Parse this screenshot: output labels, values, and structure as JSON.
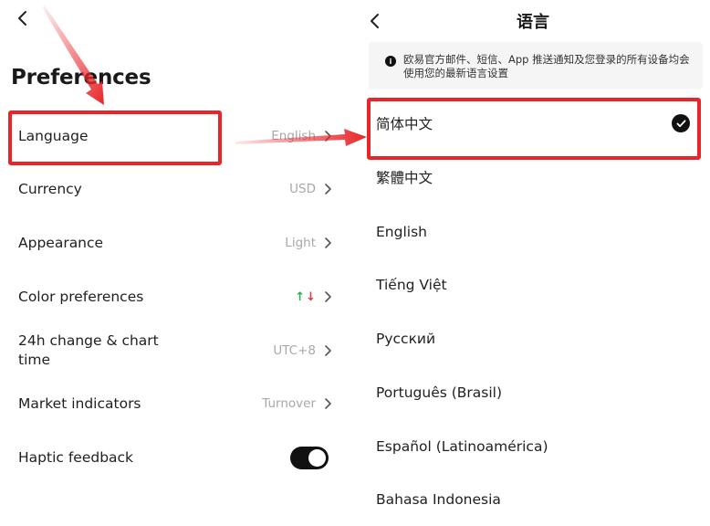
{
  "left": {
    "title": "Preferences",
    "items": [
      {
        "label": "Language",
        "value": "English"
      },
      {
        "label": "Currency",
        "value": "USD"
      },
      {
        "label": "Appearance",
        "value": "Light"
      },
      {
        "label": "Color preferences",
        "value": ""
      },
      {
        "label": "24h change & chart time",
        "value": "UTC+8"
      },
      {
        "label": "Market indicators",
        "value": "Turnover"
      },
      {
        "label": "Haptic feedback",
        "value": ""
      }
    ],
    "color_pref_symbols": {
      "up": "↑",
      "down": "↓"
    },
    "haptic_on": true
  },
  "right": {
    "title": "语言",
    "notice": "欧易官方邮件、短信、App 推送通知及您登录的所有设备均会使用您的最新语言设置",
    "info_symbol": "i",
    "languages": [
      {
        "label": "简体中文",
        "selected": true
      },
      {
        "label": "繁體中文",
        "selected": false
      },
      {
        "label": "English",
        "selected": false
      },
      {
        "label": "Tiếng Việt",
        "selected": false
      },
      {
        "label": "Русский",
        "selected": false
      },
      {
        "label": "Português (Brasil)",
        "selected": false
      },
      {
        "label": "Español (Latinoamérica)",
        "selected": false
      },
      {
        "label": "Bahasa Indonesia",
        "selected": false
      }
    ]
  },
  "colors": {
    "highlight": "#e8262a",
    "toggle_on": "#111111",
    "up": "#28b04a",
    "down": "#e2383e"
  },
  "icons": [
    "back-arrow-icon",
    "chevron-right-icon",
    "up-down-arrows-icon",
    "info-icon",
    "checkmark-icon"
  ]
}
